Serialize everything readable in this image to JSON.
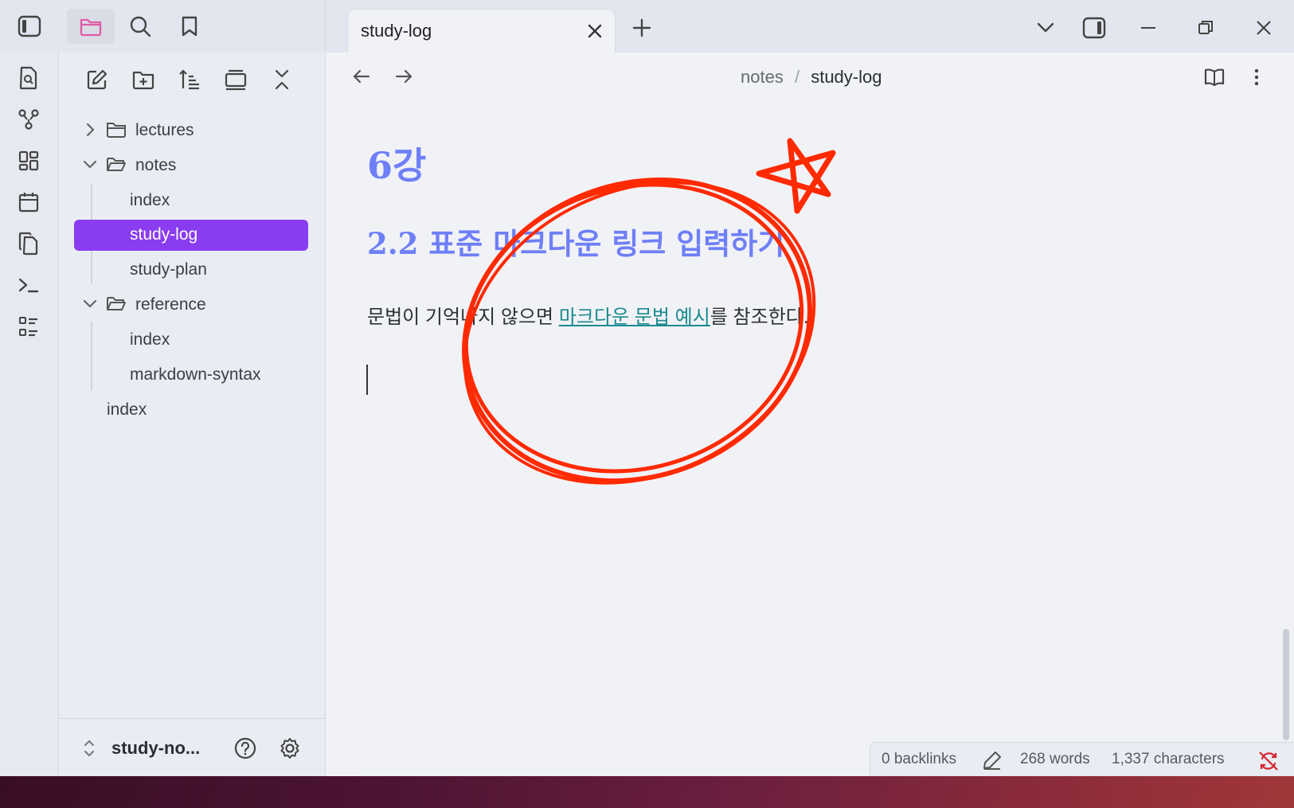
{
  "tabs": [
    {
      "label": "study-log"
    }
  ],
  "breadcrumb": {
    "parent": "notes",
    "separator": "/",
    "current": "study-log"
  },
  "file_tree": {
    "folders": [
      {
        "label": "lectures",
        "expanded": false
      },
      {
        "label": "notes",
        "expanded": true,
        "children": [
          "index",
          "study-log",
          "study-plan"
        ]
      },
      {
        "label": "reference",
        "expanded": true,
        "children": [
          "index",
          "markdown-syntax"
        ]
      }
    ],
    "root_files": [
      "index"
    ],
    "active_file": "study-log"
  },
  "vault": {
    "name": "study-no..."
  },
  "document": {
    "heading1": "6강",
    "heading2": "2.2 표준 마크다운 링크 입력하기",
    "paragraph_before": "문법이 기억나지 않으면 ",
    "link_text": "마크다운 문법 예시",
    "paragraph_after": "를 참조한다."
  },
  "status": {
    "backlinks": "0 backlinks",
    "words": "268 words",
    "characters": "1,337 characters"
  },
  "colors": {
    "accent": "#8a3cf0",
    "heading": "#6e7ff7",
    "link": "#1a8b8e",
    "annotation": "#ff2a00"
  },
  "icons": {
    "ribbon_top": [
      "sidebar-toggle-icon",
      "folder-icon",
      "search-icon",
      "bookmark-icon"
    ],
    "ribbon_left": [
      "file-search-icon",
      "graph-icon",
      "canvas-icon",
      "calendar-icon",
      "copy-icon",
      "terminal-icon",
      "list-icon"
    ],
    "sidebar_toolbar": [
      "new-note-icon",
      "new-folder-icon",
      "sort-icon",
      "collapse-all-icon",
      "close-icon"
    ]
  }
}
